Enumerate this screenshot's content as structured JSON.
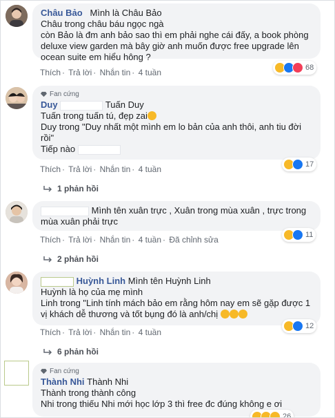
{
  "comments": [
    {
      "name": "Châu Bảo",
      "intro": "Mình là Châu Bảo",
      "lines": [
        "Châu trong châu báu ngọc ngà",
        "còn Bảo là đm anh bảo sao thì em phải nghe cái đấy, a book phòng",
        "deluxe view garden mà bây giờ anh muốn được free upgrade lên",
        "ocean suite em hiểu hông ?"
      ],
      "actions": {
        "like": "Thích",
        "reply": "Trả lời",
        "message": "Nhắn tin",
        "time": "4 tuần"
      },
      "reactions": {
        "count": "68"
      }
    },
    {
      "badge": "Fan cứng",
      "name": "Duy",
      "intro": "Tuấn Duy",
      "lines": [
        "Tuấn trong tuấn tú, đẹp zai",
        "Duy trong \"Duy nhất một mình em lo bản của anh thôi, anh tiu đời",
        "rồi\"",
        "Tiếp nào"
      ],
      "actions": {
        "like": "Thích",
        "reply": "Trả lời",
        "message": "Nhắn tin",
        "time": "4 tuần"
      },
      "reactions": {
        "count": "17"
      },
      "replies": "1 phản hồi"
    },
    {
      "intro": "Mình tên xuân trực , Xuân trong mùa xuân , trực trong",
      "lines": [
        "mùa xuân phải trực"
      ],
      "actions": {
        "like": "Thích",
        "reply": "Trả lời",
        "message": "Nhắn tin",
        "time": "4 tuần",
        "edited": "Đã chỉnh sửa"
      },
      "reactions": {
        "count": "11"
      },
      "replies": "2 phản hồi"
    },
    {
      "name": "Huỳnh Linh",
      "intro": "Mình tên Huỳnh Linh",
      "lines": [
        "Huỳnh là họ của mẹ mình",
        "Linh trong \"Linh tính mách bảo em rằng hôm nay em sẽ gặp được 1",
        "vị khách dễ thương và tốt bụng đó là anh/chị"
      ],
      "actions": {
        "like": "Thích",
        "reply": "Trả lời",
        "message": "Nhắn tin",
        "time": "4 tuần"
      },
      "reactions": {
        "count": "12"
      },
      "replies": "6 phản hồi"
    },
    {
      "badge": "Fan cứng",
      "name": "Thành Nhi",
      "intro": "Thành Nhi",
      "lines": [
        "Thành trong thành công",
        "Nhi trong thiếu Nhi mới học lớp 3 thì free đc đúng không e ơi"
      ],
      "reactions": {
        "count": "26"
      }
    }
  ]
}
